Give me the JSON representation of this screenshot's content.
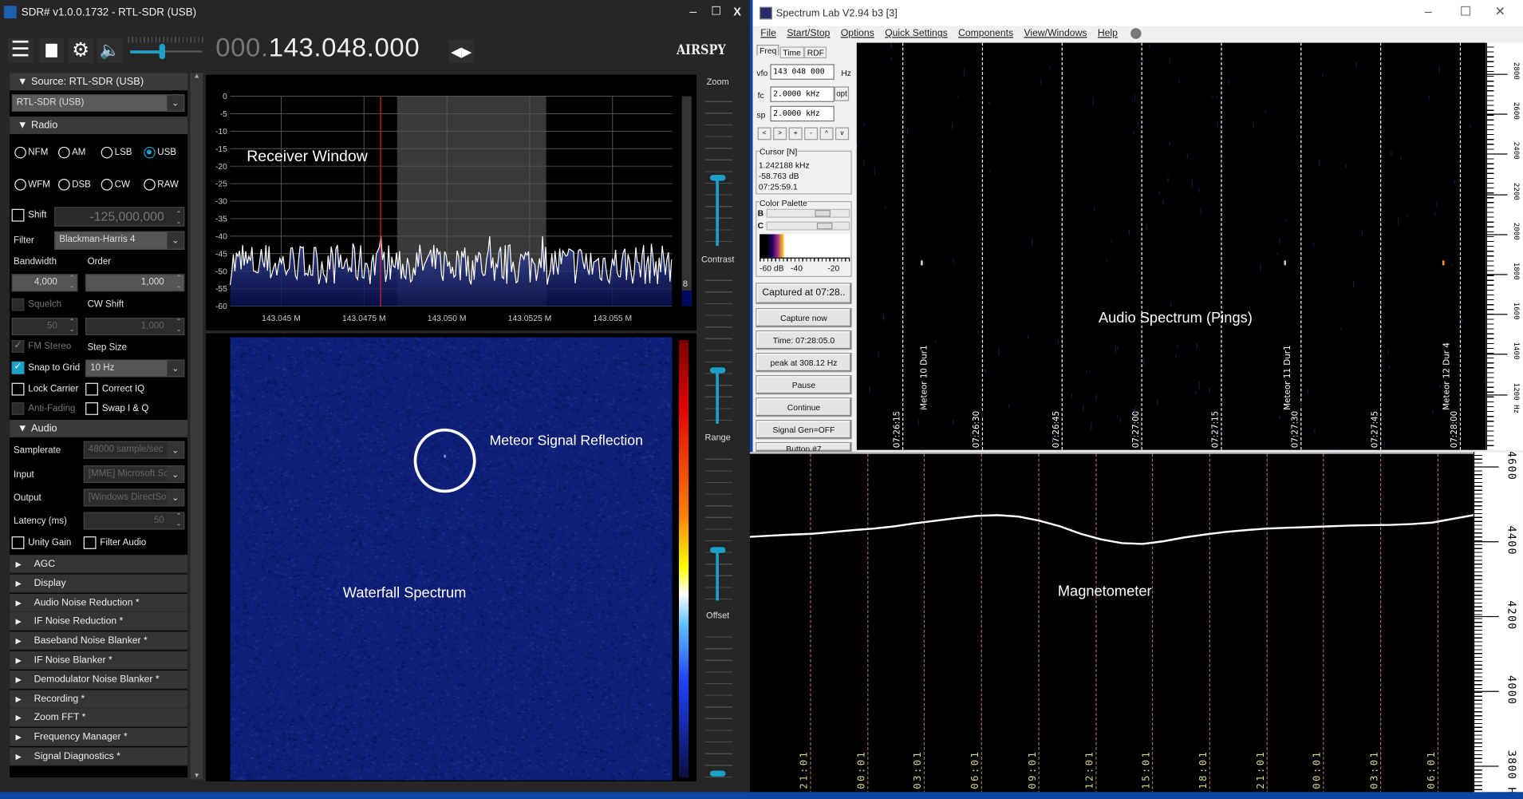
{
  "sdr": {
    "title": "SDR# v1.0.0.1732 - RTL-SDR (USB)",
    "window_controls": [
      "–",
      "☐",
      "X"
    ],
    "frequency_dim": "000.",
    "frequency": "143.048.000",
    "brand": "AIRSPY",
    "sidebar": {
      "source_header": "Source: RTL-SDR (USB)",
      "source_value": "RTL-SDR (USB)",
      "radio_header": "Radio",
      "modes": [
        {
          "label": "NFM",
          "selected": false
        },
        {
          "label": "AM",
          "selected": false
        },
        {
          "label": "LSB",
          "selected": false
        },
        {
          "label": "USB",
          "selected": true
        },
        {
          "label": "WFM",
          "selected": false
        },
        {
          "label": "DSB",
          "selected": false
        },
        {
          "label": "CW",
          "selected": false
        },
        {
          "label": "RAW",
          "selected": false
        }
      ],
      "shift_label": "Shift",
      "shift_value": "-125,000,000",
      "filter_label": "Filter",
      "filter_value": "Blackman-Harris 4",
      "bandwidth_label": "Bandwidth",
      "bandwidth_value": "4,000",
      "order_label": "Order",
      "order_value": "1,000",
      "squelch_label": "Squelch",
      "squelch_value": "50",
      "cw_shift_label": "CW Shift",
      "cw_shift_value": "1,000",
      "fm_stereo_label": "FM Stereo",
      "step_size_label": "Step Size",
      "snap_label": "Snap to Grid",
      "step_size_value": "10 Hz",
      "lock_carrier_label": "Lock Carrier",
      "correct_iq_label": "Correct IQ",
      "anti_fading_label": "Anti-Fading",
      "swap_iq_label": "Swap I & Q",
      "audio_header": "Audio",
      "samplerate_label": "Samplerate",
      "samplerate_value": "48000 sample/sec",
      "input_label": "Input",
      "input_value": "[MME] Microsoft So",
      "output_label": "Output",
      "output_value": "[Windows DirectSou",
      "latency_label": "Latency (ms)",
      "latency_value": "50",
      "unity_gain_label": "Unity Gain",
      "filter_audio_label": "Filter Audio",
      "sections": [
        "AGC",
        "Display",
        "Audio Noise Reduction *",
        "IF Noise Reduction *",
        "Baseband Noise Blanker *",
        "IF Noise Blanker *",
        "Demodulator Noise Blanker *",
        "Recording *",
        "Zoom FFT *",
        "Frequency Manager *",
        "Signal Diagnostics *"
      ]
    },
    "sliders": {
      "zoom": "Zoom",
      "contrast": "Contrast",
      "range": "Range",
      "offset": "Offset"
    },
    "spectrum": {
      "y_ticks": [
        "0",
        "-5",
        "-10",
        "-15",
        "-20",
        "-25",
        "-30",
        "-35",
        "-40",
        "-45",
        "-50",
        "-55",
        "-60"
      ],
      "x_ticks": [
        "143.045 M",
        "143.0475 M",
        "143.050 M",
        "143.0525 M",
        "143.055 M"
      ],
      "annotation": "Receiver Window",
      "level_value": "8",
      "tuned_mhz": 143.048,
      "passband_mhz": [
        143.0485,
        143.053
      ],
      "noise_floor_db": -48
    },
    "waterfall": {
      "annotation": "Waterfall Spectrum",
      "meteor_label": "Meteor Signal Reflection"
    }
  },
  "spectrum_lab": {
    "title": "Spectrum Lab V2.94 b3 [3]",
    "menu": [
      "File",
      "Start/Stop",
      "Options",
      "Quick Settings",
      "Components",
      "View/Windows",
      "Help"
    ],
    "tabs": [
      "Freq",
      "Time",
      "RDF"
    ],
    "vfo_label": "vfo",
    "vfo_value": "143 048 000",
    "vfo_unit": "Hz",
    "fc_label": "fc",
    "fc_value": "2.0000 kHz",
    "opt_label": "opt",
    "sp_label": "sp",
    "sp_value": "2.0000 kHz",
    "nav_buttons": [
      "<",
      ">",
      "+",
      "-",
      "^",
      "v"
    ],
    "cursor_title": "Cursor [N]",
    "cursor_lines": [
      "1.242188 kHz",
      "-58.763 dB",
      "07:25:59.1"
    ],
    "palette_title": "Color Palette",
    "palette_b": "B",
    "palette_c": "C",
    "palette_scale": [
      "-60 dB",
      "-40",
      "-20"
    ],
    "buttons": [
      "Captured at 07:28..",
      "Capture now",
      "Time:  07:28:05.0",
      "peak at 308.12 Hz",
      "Pause",
      "Continue",
      "Signal Gen=OFF",
      "Button #7"
    ],
    "annotation": "Audio Spectrum (Pings)",
    "time_labels": [
      "07:26:15",
      "07:26:30",
      "07:26:45",
      "07:27:00",
      "07:27:15",
      "07:27:30",
      "07:27:45",
      "07:28:00"
    ],
    "meteor_labels": [
      "Meteor 10 Dur1",
      "Meteor 11 Dur1",
      "Meteor 12 Dur 4"
    ],
    "freq_axis": [
      "2800",
      "2600",
      "2400",
      "2200",
      "2000",
      "1800",
      "1600",
      "1400",
      "1200 Hz"
    ]
  },
  "magnetometer": {
    "annotation": "Magnetometer",
    "time_labels": [
      "21:01",
      "00:01",
      "03:01",
      "06:01",
      "09:01",
      "12:01",
      "15:01",
      "18:01",
      "21:01",
      "00:01",
      "03:01",
      "06:01"
    ],
    "axis": [
      "4600",
      "4400",
      "4200",
      "4000",
      "3800 Hz"
    ],
    "trace": [
      4412,
      4415,
      4418,
      4420,
      4425,
      4430,
      4434,
      4440,
      4448,
      4455,
      4462,
      4468,
      4470,
      4466,
      4455,
      4440,
      4420,
      4405,
      4395,
      4393,
      4400,
      4410,
      4418,
      4425,
      4430,
      4434,
      4436,
      4438,
      4440,
      4442,
      4443,
      4444,
      4446,
      4450,
      4460,
      4470
    ]
  },
  "colors": {
    "accent": "#1ca1c9",
    "sdr_bg": "#262626",
    "waterfall": "#0e1f78",
    "spectrum_fill": "#1c2a7a"
  }
}
